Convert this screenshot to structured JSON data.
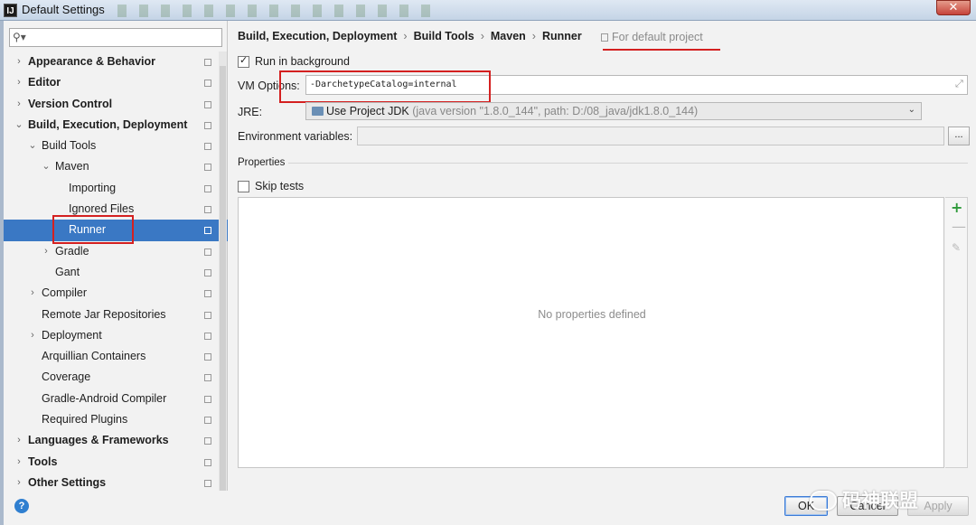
{
  "window": {
    "title": "Default Settings",
    "app_icon": "IJ",
    "close_glyph": "✕"
  },
  "sidebar": {
    "search_placeholder": "",
    "items": [
      {
        "label": "Appearance & Behavior",
        "level": 0,
        "bold": true,
        "chevron": "›"
      },
      {
        "label": "Editor",
        "level": 0,
        "bold": true,
        "chevron": "›"
      },
      {
        "label": "Version Control",
        "level": 0,
        "bold": true,
        "chevron": "›"
      },
      {
        "label": "Build, Execution, Deployment",
        "level": 0,
        "bold": true,
        "chevron": "⌄"
      },
      {
        "label": "Build Tools",
        "level": 1,
        "chevron": "⌄"
      },
      {
        "label": "Maven",
        "level": 2,
        "chevron": "⌄"
      },
      {
        "label": "Importing",
        "level": 3,
        "chevron": ""
      },
      {
        "label": "Ignored Files",
        "level": 3,
        "chevron": ""
      },
      {
        "label": "Runner",
        "level": 3,
        "chevron": "",
        "selected": true
      },
      {
        "label": "Gradle",
        "level": 2,
        "chevron": "›"
      },
      {
        "label": "Gant",
        "level": 2,
        "chevron": ""
      },
      {
        "label": "Compiler",
        "level": 1,
        "chevron": "›"
      },
      {
        "label": "Remote Jar Repositories",
        "level": 1,
        "chevron": ""
      },
      {
        "label": "Deployment",
        "level": 1,
        "chevron": "›"
      },
      {
        "label": "Arquillian Containers",
        "level": 1,
        "chevron": ""
      },
      {
        "label": "Coverage",
        "level": 1,
        "chevron": ""
      },
      {
        "label": "Gradle-Android Compiler",
        "level": 1,
        "chevron": ""
      },
      {
        "label": "Required Plugins",
        "level": 1,
        "chevron": ""
      },
      {
        "label": "Languages & Frameworks",
        "level": 0,
        "bold": true,
        "chevron": "›"
      },
      {
        "label": "Tools",
        "level": 0,
        "bold": true,
        "chevron": "›"
      },
      {
        "label": "Other Settings",
        "level": 0,
        "bold": true,
        "chevron": "›"
      }
    ]
  },
  "breadcrumb": {
    "items": [
      "Build, Execution, Deployment",
      "Build Tools",
      "Maven",
      "Runner"
    ],
    "separator": "›",
    "scope": "For default project"
  },
  "runner": {
    "run_in_background_label": "Run in background",
    "run_in_background_checked": true,
    "vm_options_label": "VM Options:",
    "vm_options_value": "-DarchetypeCatalog=internal",
    "jre_label": "JRE:",
    "jre_value": "Use Project JDK",
    "jre_detail": "(java version \"1.8.0_144\", path: D:/08_java/jdk1.8.0_144)",
    "env_label": "Environment variables:",
    "env_value": "",
    "env_button": "...",
    "properties_title": "Properties",
    "skip_tests_label": "Skip tests",
    "skip_tests_checked": false,
    "no_properties": "No properties defined",
    "tool_add": "+",
    "tool_remove": "—",
    "tool_edit": "✎"
  },
  "buttons": {
    "ok": "OK",
    "cancel": "Cancel",
    "apply": "Apply",
    "help": "?"
  },
  "watermark": "码神联盟",
  "colors": {
    "selection": "#3a78c4",
    "highlight_red": "#d42020",
    "add_green": "#2e9a3a"
  }
}
